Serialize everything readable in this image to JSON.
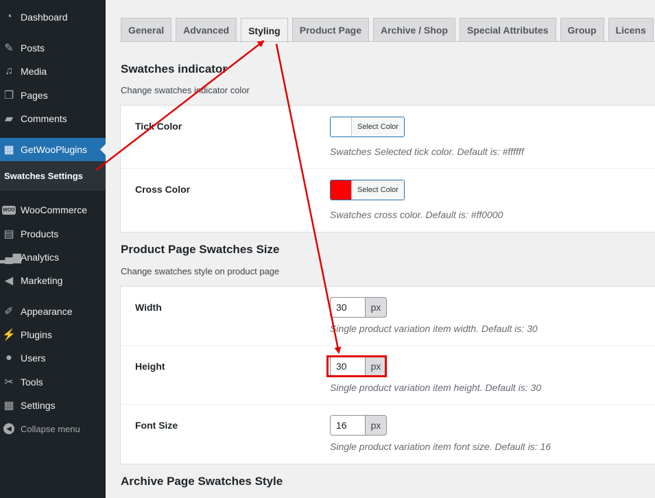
{
  "sidebar": {
    "items": [
      {
        "label": "Dashboard",
        "icon": "dashboard-icon"
      },
      {
        "label": "Posts",
        "icon": "pin-icon"
      },
      {
        "label": "Media",
        "icon": "media-icon"
      },
      {
        "label": "Pages",
        "icon": "pages-icon"
      },
      {
        "label": "Comments",
        "icon": "comment-icon"
      },
      {
        "label": "GetWooPlugins",
        "icon": "plugin-icon"
      },
      {
        "label": "WooCommerce",
        "icon": "woo-icon"
      },
      {
        "label": "Products",
        "icon": "archive-icon"
      },
      {
        "label": "Analytics",
        "icon": "bar-chart-icon"
      },
      {
        "label": "Marketing",
        "icon": "megaphone-icon"
      },
      {
        "label": "Appearance",
        "icon": "brush-icon"
      },
      {
        "label": "Plugins",
        "icon": "plug-icon"
      },
      {
        "label": "Users",
        "icon": "user-icon"
      },
      {
        "label": "Tools",
        "icon": "wrench-icon"
      },
      {
        "label": "Settings",
        "icon": "settings-icon"
      }
    ],
    "submenu_label": "Swatches Settings",
    "collapse_label": "Collapse menu",
    "woo_badge": "WOO"
  },
  "tabs": [
    "General",
    "Advanced",
    "Styling",
    "Product Page",
    "Archive / Shop",
    "Special Attributes",
    "Group",
    "Licens"
  ],
  "active_tab": "Styling",
  "sections": {
    "indicator": {
      "title": "Swatches indicator",
      "desc": "Change swatches indicator color",
      "rows": [
        {
          "label": "Tick Color",
          "button": "Select Color",
          "color": "#ffffff",
          "help": "Swatches Selected tick color. Default is: #ffffff"
        },
        {
          "label": "Cross Color",
          "button": "Select Color",
          "color": "#ff0000",
          "help": "Swatches cross color. Default is: #ff0000"
        }
      ]
    },
    "size": {
      "title": "Product Page Swatches Size",
      "desc": "Change swatches style on product page",
      "rows": [
        {
          "label": "Width",
          "value": "30",
          "unit": "px",
          "help": "Single product variation item width. Default is: 30"
        },
        {
          "label": "Height",
          "value": "30",
          "unit": "px",
          "help": "Single product variation item height. Default is: 30"
        },
        {
          "label": "Font Size",
          "value": "16",
          "unit": "px",
          "help": "Single product variation item font size. Default is: 16"
        }
      ]
    },
    "archive": {
      "title": "Archive Page Swatches Style"
    }
  },
  "colors": {
    "sidebar_bg": "#1d2327",
    "accent": "#2271b1",
    "annotation": "#e00000"
  }
}
